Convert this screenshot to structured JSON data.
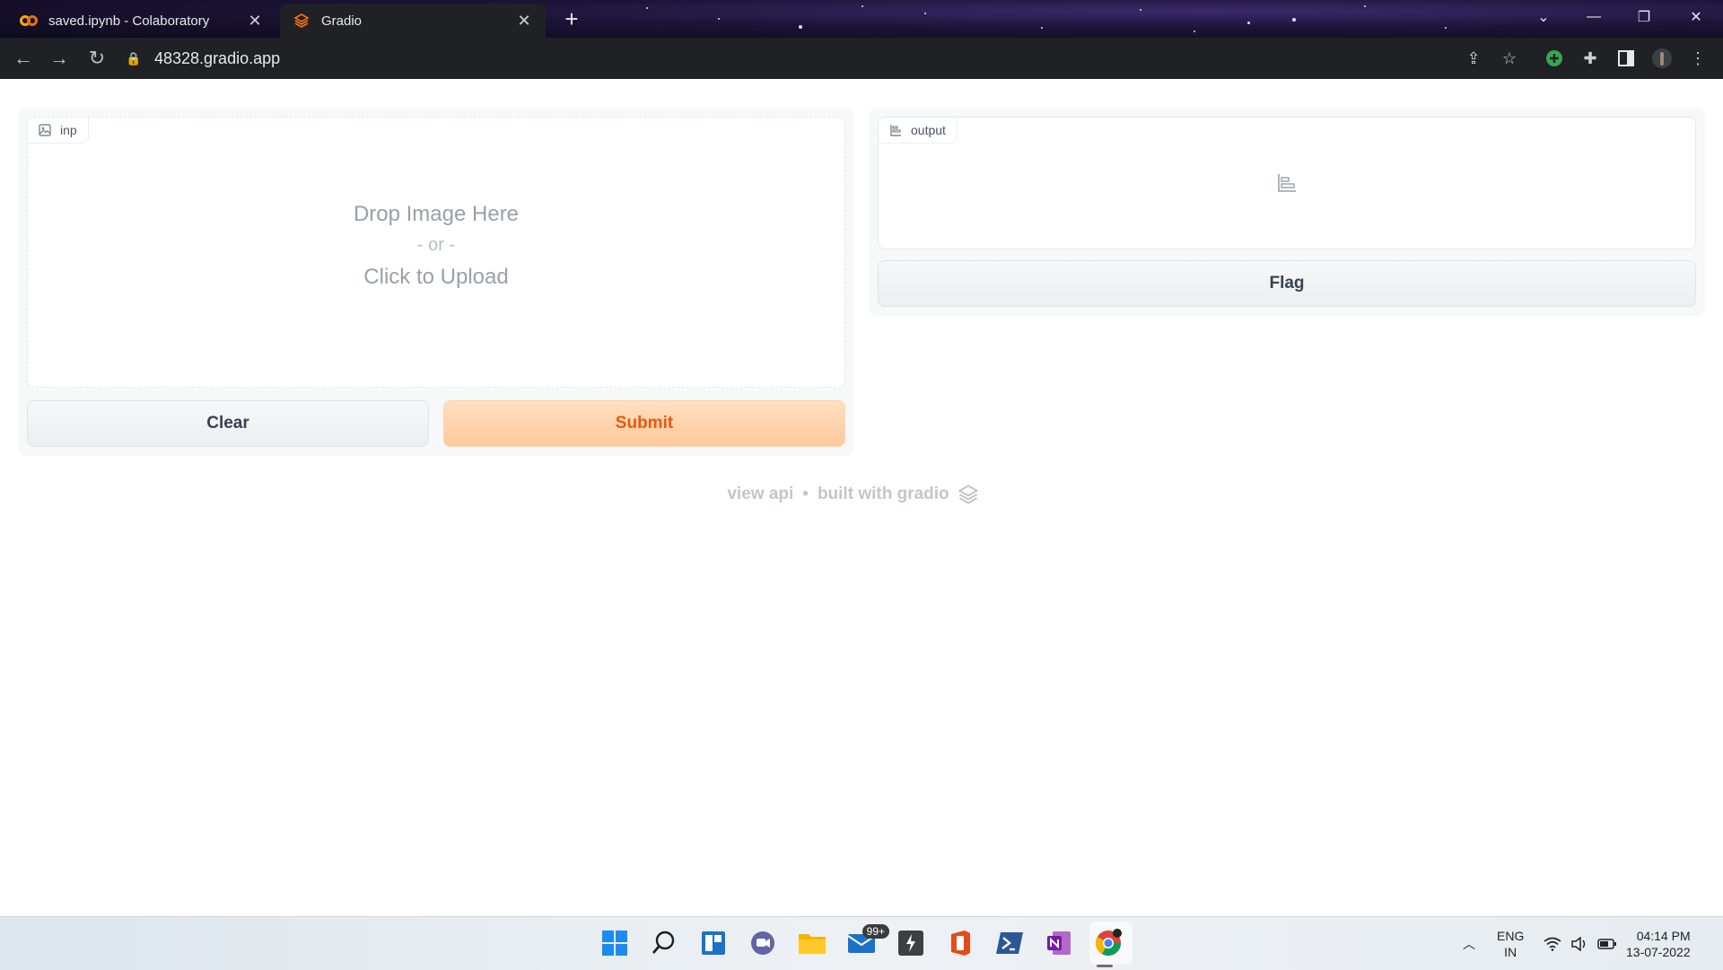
{
  "browser": {
    "tabs": [
      {
        "title": "saved.ipynb - Colaboratory",
        "icon": "colab-icon",
        "active": false
      },
      {
        "title": "Gradio",
        "icon": "gradio-icon",
        "active": true
      }
    ],
    "url": "48328.gradio.app"
  },
  "gradio": {
    "input": {
      "label": "inp",
      "drop_text": "Drop Image Here",
      "or_text": "- or -",
      "upload_text": "Click to Upload"
    },
    "output": {
      "label": "output"
    },
    "buttons": {
      "clear": "Clear",
      "submit": "Submit",
      "flag": "Flag"
    },
    "footer": {
      "view_api": "view api",
      "separator": "•",
      "built_with": "built with gradio"
    },
    "colors": {
      "submit_text": "#ea580c",
      "submit_bg": "#ffc99a"
    }
  },
  "taskbar": {
    "mail_badge": "99+",
    "language": {
      "lang": "ENG",
      "region": "IN"
    },
    "clock": {
      "time": "04:14 PM",
      "date": "13-07-2022"
    }
  }
}
